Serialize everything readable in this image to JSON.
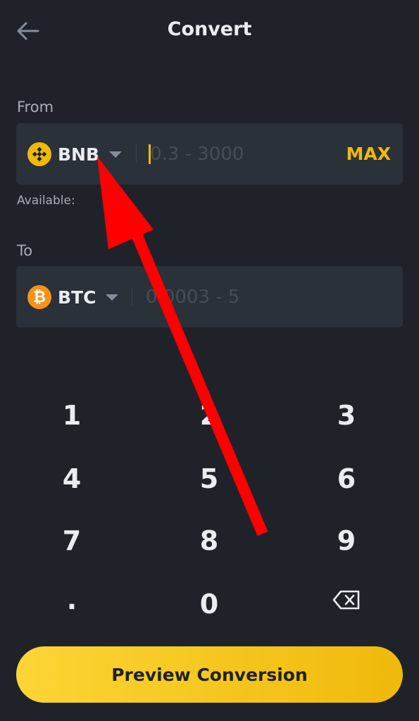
{
  "header": {
    "title": "Convert",
    "back_icon": "arrow-left-icon"
  },
  "from": {
    "label": "From",
    "coin": "BNB",
    "coin_icon": "bnb-icon",
    "coin_color": "#f0b90b",
    "placeholder": "0.3 - 3000",
    "max_label": "MAX",
    "available_label": "Available:"
  },
  "to": {
    "label": "To",
    "coin": "BTC",
    "coin_icon": "btc-icon",
    "coin_color": "#f7931a",
    "placeholder": "0.0003 - 5"
  },
  "keypad": {
    "keys": [
      "1",
      "2",
      "3",
      "4",
      "5",
      "6",
      "7",
      "8",
      "9",
      ".",
      "0"
    ],
    "backspace_icon": "backspace-icon"
  },
  "preview_button": "Preview Conversion",
  "colors": {
    "background": "#1f2329",
    "field": "#2b3139",
    "accent": "#f0b90b",
    "annotation_arrow": "#ff0000"
  }
}
